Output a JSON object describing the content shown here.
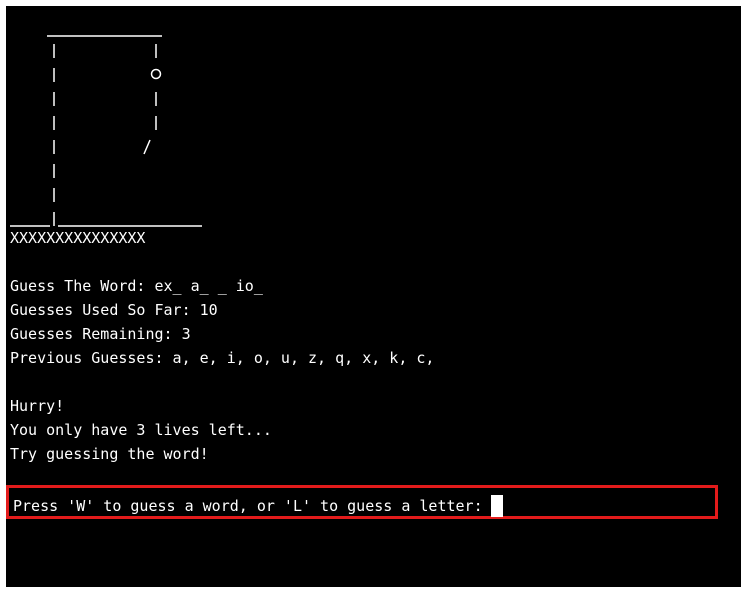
{
  "ascii_art": {
    "floor_text": "XXXXXXXXXXXXXXX"
  },
  "game": {
    "word_label": "Guess The Word: ex_ a_ _ io_",
    "guesses_used": "Guesses Used So Far: 10",
    "guesses_remaining": "Guesses Remaining: 3",
    "previous_guesses": "Previous Guesses: a, e, i, o, u, z, q, x, k, c,"
  },
  "messages": {
    "hurry": "Hurry!",
    "lives_left": "You only have 3 lives left...",
    "try_word": "Try guessing the word!"
  },
  "prompt": {
    "text": "Press 'W' to guess a word, or 'L' to guess a letter:"
  },
  "colors": {
    "background": "#000000",
    "text": "#ffffff",
    "highlight_border": "#e31b1b"
  }
}
